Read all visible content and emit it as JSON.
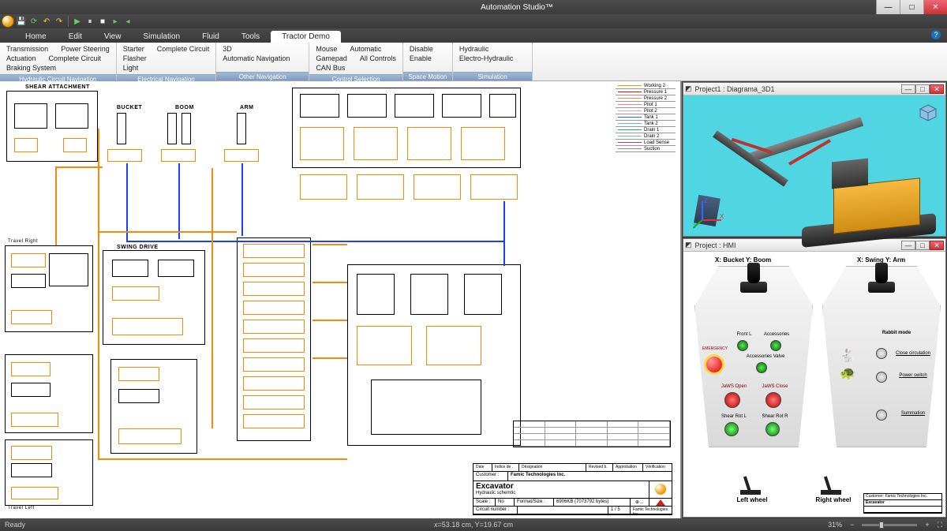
{
  "title": "Automation Studio™",
  "qat_icons": [
    "orb",
    "save-icon",
    "refresh-icon",
    "undo-icon",
    "redo-icon",
    "sep",
    "play-icon",
    "pause-icon",
    "stop-icon",
    "step-icon",
    "slow-icon"
  ],
  "tabs": [
    "Home",
    "Edit",
    "View",
    "Simulation",
    "Fluid",
    "Tools",
    "Tractor Demo"
  ],
  "active_tab": "Tractor Demo",
  "ribbon_groups": [
    {
      "label": "Hydraulic Circuit Navigation",
      "rows": [
        [
          "Transmission",
          "Power Steering"
        ],
        [
          "Actuation",
          "Complete Circuit"
        ],
        [
          "Braking System",
          ""
        ]
      ]
    },
    {
      "label": "Electrical Navigation",
      "rows": [
        [
          "Starter",
          "Complete Circuit"
        ],
        [
          "Flasher",
          ""
        ],
        [
          "Light",
          ""
        ]
      ]
    },
    {
      "label": "Other Navigation",
      "rows": [
        [
          "3D",
          ""
        ],
        [
          "Automatic Navigation",
          ""
        ],
        [
          "",
          ""
        ]
      ]
    },
    {
      "label": "Control Selection",
      "rows": [
        [
          "Mouse",
          "Automatic"
        ],
        [
          "Gamepad",
          "All Controls"
        ],
        [
          "CAN Bus",
          ""
        ]
      ]
    },
    {
      "label": "Space Motion",
      "rows": [
        [
          "Disable",
          ""
        ],
        [
          "Enable",
          ""
        ],
        [
          "",
          ""
        ]
      ]
    },
    {
      "label": "Simulation",
      "rows": [
        [
          "Hydraulic",
          ""
        ],
        [
          "Electro-Hydraulic",
          ""
        ],
        [
          "",
          ""
        ]
      ]
    }
  ],
  "schematic": {
    "labels": {
      "shear": "SHEAR ATTACHMENT",
      "bucket": "BUCKET",
      "boom": "BOOM",
      "arm": "ARM",
      "swing": "SWING DRIVE",
      "tright": "Travel Right",
      "tleft": "Travel Left"
    }
  },
  "legend": [
    {
      "name": "Working 2",
      "color": "#d9a300"
    },
    {
      "name": "Pressure 1",
      "color": "#d11"
    },
    {
      "name": "Pressure 2",
      "color": "#e85"
    },
    {
      "name": "Pilot 1",
      "color": "#f77"
    },
    {
      "name": "Pilot 2",
      "color": "#f99"
    },
    {
      "name": "Tank 1",
      "color": "#26f"
    },
    {
      "name": "Tank 2",
      "color": "#5bf"
    },
    {
      "name": "Drain 1",
      "color": "#2a7"
    },
    {
      "name": "Drain 2",
      "color": "#6c9"
    },
    {
      "name": "Load Sense",
      "color": "#949"
    },
    {
      "name": "Suction",
      "color": "#888"
    }
  ],
  "title_block": {
    "headers": [
      "Date",
      "Indice de .",
      "Désignation",
      "Revised b.",
      "Approbation",
      "Vérification"
    ],
    "customer_label": "Customer :",
    "customer": "Famic Technologies Inc.",
    "project": "Excavator",
    "subtitle": "Hydraulic schemtic",
    "scale_label": "Scale :",
    "scale": "No",
    "format_label": "Format/Size :",
    "format": "6906KB (7073792 bytes)",
    "circuit_label": "Circuit number :",
    "page": "1 / 5",
    "logo_footer": "Famic Technologies Inc."
  },
  "panel_3d": {
    "title": "Project1 : Diagrama_3D1",
    "axes": {
      "x": "X",
      "y": "Y",
      "z": "Z"
    }
  },
  "panel_hmi": {
    "title": "Project : HMI",
    "left_joy": "X: Bucket Y: Boom",
    "right_joy": "X: Swing Y: Arm",
    "labels": {
      "emergency": "EMERGENCY",
      "front_l": "Front L",
      "accessories": "Accessories",
      "acc_valve": "Accessories Valve",
      "jaws_open": "JaWS Open",
      "jaws_close": "JaWS Close",
      "shear_rot_l": "Shear Rot L",
      "shear_rot_r": "Shear Rot R",
      "rabbit": "Rabbit mode",
      "close_circ": "Close circulation",
      "power": "Power switch",
      "summation": "Summation",
      "left_wheel": "Left wheel",
      "right_wheel": "Right wheel"
    },
    "tb": {
      "customer": "Customer:  Famic Technologies Inc.",
      "proj": "Excavator"
    }
  },
  "status": {
    "ready": "Ready",
    "coords": "x=53.18 cm, Y=19.67 cm",
    "zoom": "31%"
  }
}
